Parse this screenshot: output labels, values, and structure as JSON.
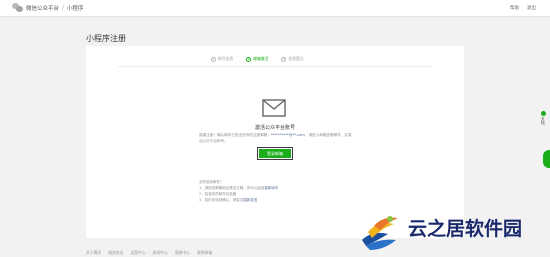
{
  "header": {
    "brand": "微信公众平台",
    "separator": "/",
    "section": "小程序",
    "links": [
      "帮助",
      "退出"
    ]
  },
  "page": {
    "title": "小程序注册"
  },
  "steps": [
    {
      "num": "1",
      "label": "帐号信息",
      "active": false
    },
    {
      "num": "2",
      "label": "邮箱激活",
      "active": true
    },
    {
      "num": "3",
      "label": "信息登记",
      "active": false
    }
  ],
  "activation": {
    "title": "激活公众平台账号",
    "desc_prefix": "感谢注册！确认邮件已发送至你的注册邮箱：",
    "email": "**********@**.com",
    "desc_suffix": "，请进入邮箱查看邮件，并激活公众平台帐号。",
    "button": "登录邮箱"
  },
  "notes": {
    "heading": "没有收到邮件？",
    "items": [
      {
        "text": "1、请检查邮箱地址是否正确，你可以返回",
        "link": "重新填写"
      },
      {
        "text": "2、检查你的邮件垃圾箱",
        "link": ""
      },
      {
        "text": "3、若仍未收到确认，请尝试",
        "link": "重新发送"
      }
    ]
  },
  "footer": {
    "links": [
      "关于腾讯",
      "服务协议",
      "运营中心",
      "辟谣中心",
      "客服中心",
      "联系邮箱"
    ]
  },
  "side": {
    "label": "文档"
  },
  "watermark": {
    "text": "云之居软件园"
  },
  "colors": {
    "accent": "#1aad19",
    "link": "#576b95",
    "watermark_text": "#1a2a6c"
  }
}
